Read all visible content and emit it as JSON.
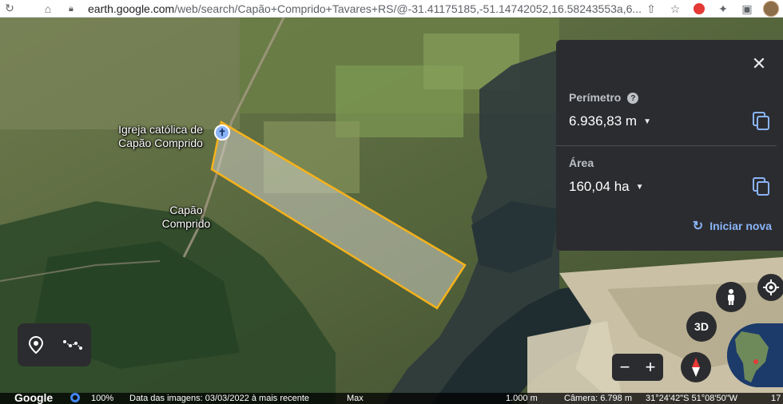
{
  "browser": {
    "url_host": "earth.google.com",
    "url_path": "/web/search/Capão+Comprido+Tavares+RS/@-31.41175185,-51.14742052,16.58243553a,6..."
  },
  "map": {
    "labels": {
      "church_line1": "Igreja católica de",
      "church_line2": "Capão Comprido",
      "place_line1": "Capão",
      "place_line2": "Comprido"
    }
  },
  "panel": {
    "perimeter_label": "Perímetro",
    "perimeter_value": "6.936,83 m",
    "area_label": "Área",
    "area_value": "160,04 ha",
    "restart_label": "Iniciar nova",
    "close_icon": "close-icon",
    "copy_icon": "copy-icon"
  },
  "controls": {
    "view_3d_label": "3D",
    "zoom_out": "−",
    "zoom_in": "+"
  },
  "status_bar": {
    "logo": "Google",
    "percent": "100%",
    "imagery_date": "Data das imagens: 03/03/2022 à mais recente",
    "max": "Max",
    "scale": "1.000 m",
    "camera": "Câmera: 6.798 m",
    "coords": "31°24'42\"S 51°08'50\"W",
    "trailing": "17"
  },
  "colors": {
    "panel_bg": "#2b2c2f",
    "accent_blue": "#8ab4f8",
    "polygon_stroke": "#f6b21b"
  }
}
